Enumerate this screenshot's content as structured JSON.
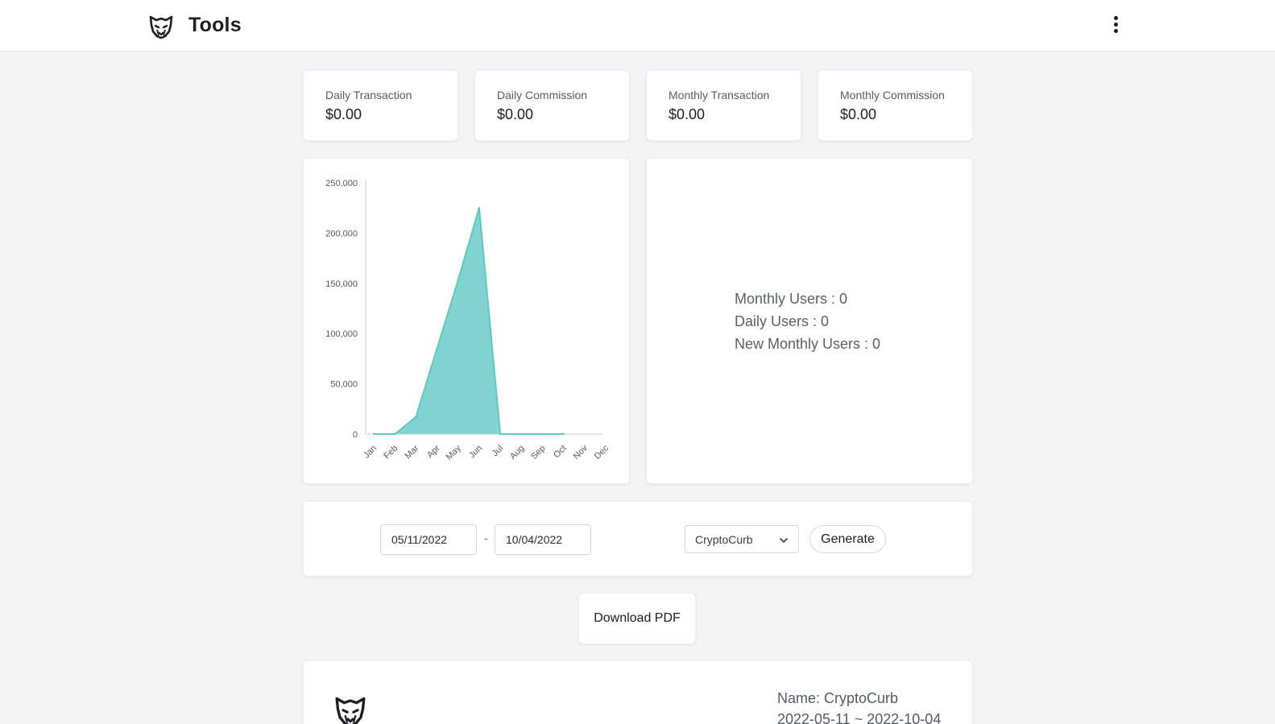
{
  "header": {
    "title": "Tools",
    "logo_icon": "tiger-head-icon",
    "menu_icon": "kebab-menu-icon"
  },
  "stats": [
    {
      "label": "Daily Transaction",
      "value": "$0.00"
    },
    {
      "label": "Daily Commission",
      "value": "$0.00"
    },
    {
      "label": "Monthly Transaction",
      "value": "$0.00"
    },
    {
      "label": "Monthly Commission",
      "value": "$0.00"
    }
  ],
  "chart_data": {
    "type": "area",
    "categories": [
      "Jan",
      "Feb",
      "Mar",
      "Apr",
      "May",
      "Jun",
      "Jul",
      "Aug",
      "Sep",
      "Oct",
      "Nov",
      "Dec"
    ],
    "values": [
      0,
      0,
      17000,
      85000,
      153000,
      225000,
      0,
      0,
      0,
      0,
      null,
      null
    ],
    "yticks": [
      0,
      50000,
      100000,
      150000,
      200000,
      250000
    ],
    "ytick_labels": [
      "0",
      "50,000",
      "100,000",
      "150,000",
      "200,000",
      "250,000"
    ],
    "ylim": [
      0,
      250000
    ],
    "color": "#5cc9c5",
    "fill": "#80d3d1"
  },
  "users": {
    "monthly": "Monthly Users : 0",
    "daily": "Daily Users : 0",
    "new_monthly": "New Monthly Users : 0"
  },
  "filter": {
    "start_date": "05/11/2022",
    "separator": "-",
    "end_date": "10/04/2022",
    "selected_brand": "CryptoCurb",
    "generate_label": "Generate"
  },
  "download_label": "Download PDF",
  "report": {
    "name": "Name: CryptoCurb",
    "range": "2022-05-11 ~ 2022-10-04"
  }
}
